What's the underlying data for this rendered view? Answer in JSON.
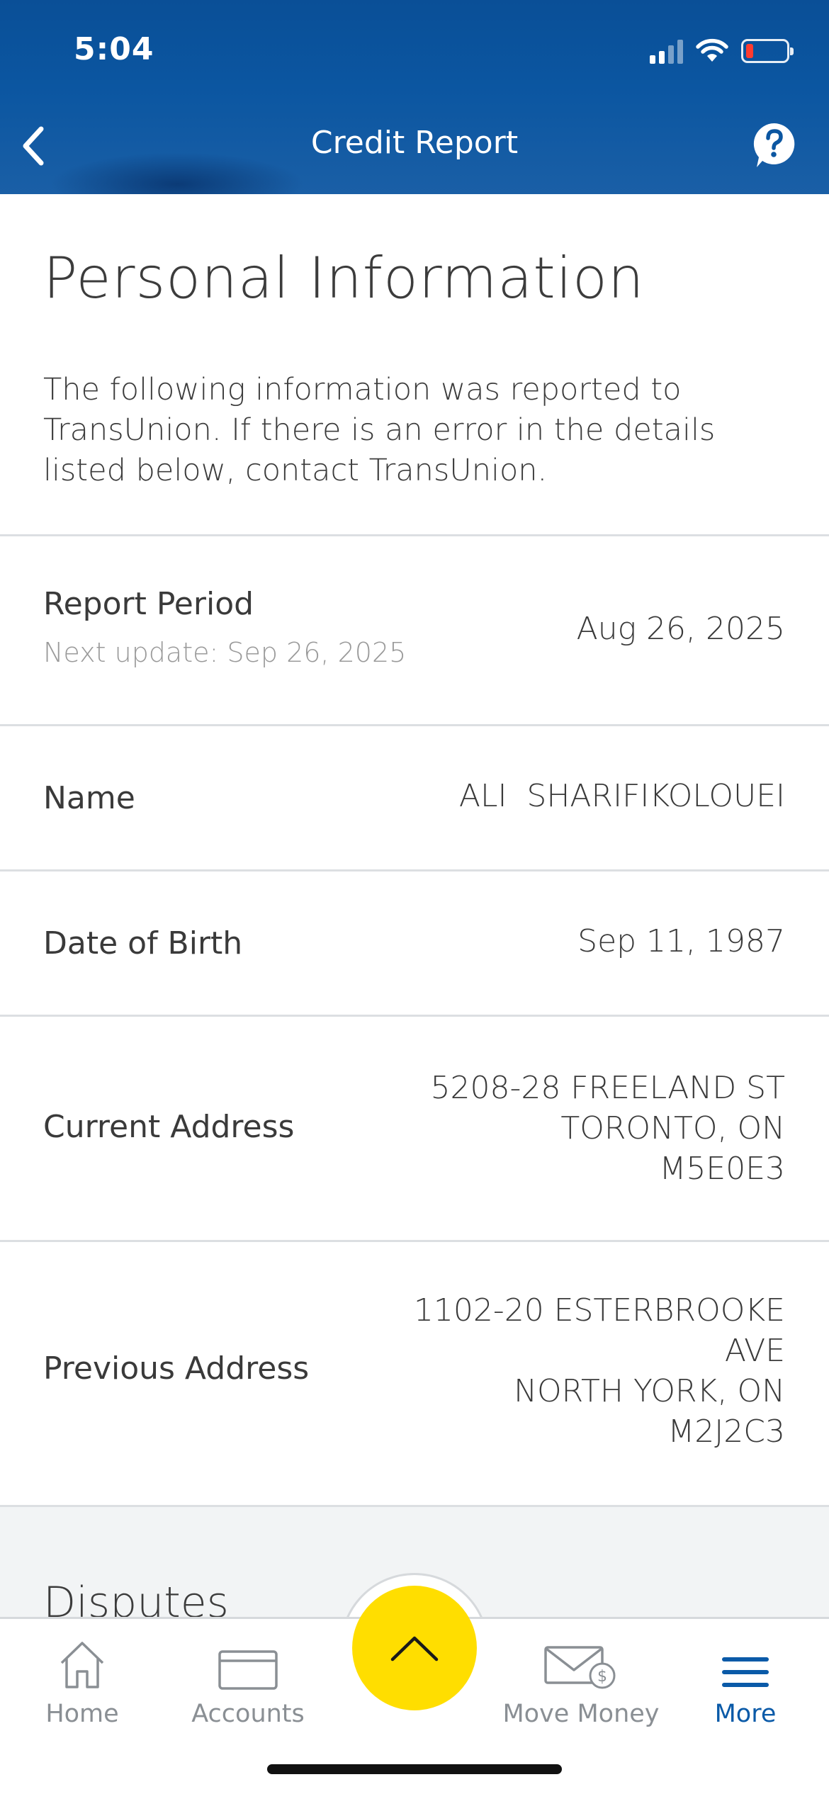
{
  "status_bar": {
    "time": "5:04"
  },
  "header": {
    "title": "Credit Report",
    "back_icon": "chevron-left-icon",
    "help_icon": "question-bubble-icon"
  },
  "page": {
    "title": "Personal Information",
    "intro": "The following information was reported to TransUnion. If there is an error in the details listed below, contact TransUnion."
  },
  "rows": {
    "report_period": {
      "label": "Report Period",
      "sublabel": "Next update: Sep 26, 2025",
      "value": "Aug 26, 2025"
    },
    "name": {
      "label": "Name",
      "value": "ALI  SHARIFIKOLOUEI"
    },
    "dob": {
      "label": "Date of Birth",
      "value": "Sep 11, 1987"
    },
    "current_address": {
      "label": "Current Address",
      "value": "5208-28 FREELAND ST\nTORONTO, ON\nM5E0E3"
    },
    "previous_address": {
      "label": "Previous Address",
      "value": "1102-20 ESTERBROOKE\nAVE\nNORTH YORK, ON\nM2J2C3"
    }
  },
  "disputes": {
    "title": "Disputes"
  },
  "tabbar": {
    "home": "Home",
    "accounts": "Accounts",
    "move_money": "Move Money",
    "more": "More",
    "active": "More",
    "fab_icon": "chevron-up-icon"
  },
  "colors": {
    "header_blue": "#0b56a1",
    "accent_blue": "#0a5aa8",
    "fab_yellow": "#ffde00",
    "battery_low": "#ff3b30"
  }
}
